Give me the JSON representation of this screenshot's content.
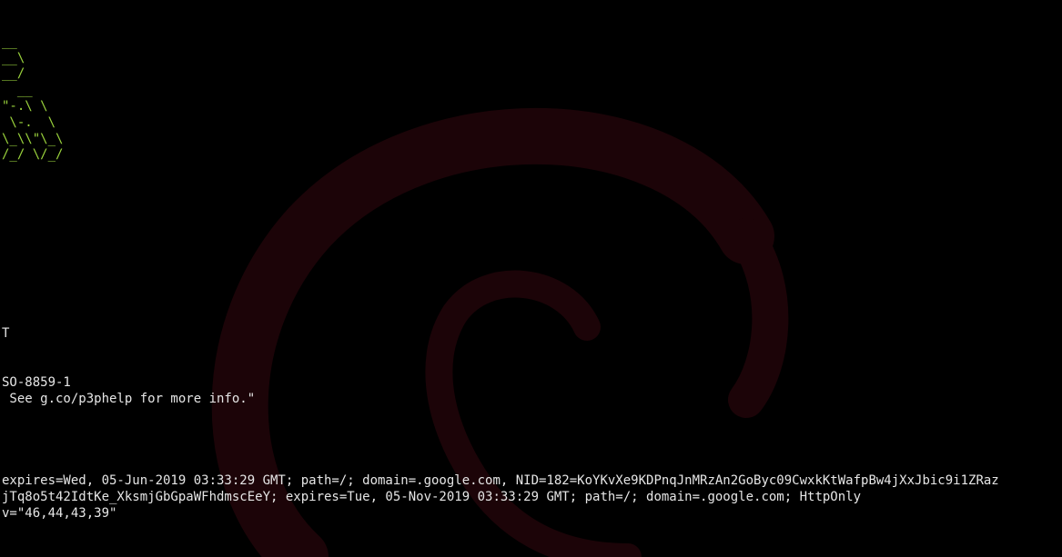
{
  "terminal": {
    "banner": [
      "__",
      "__\\",
      "__/",
      "  __",
      "\"-.\\ \\",
      " \\-.  \\",
      "\\_\\\\\"\\_\\",
      "/_/ \\/_/"
    ],
    "output": [
      "T",
      "SO-8859-1",
      " See g.co/p3phelp for more info.\"",
      "expires=Wed, 05-Jun-2019 03:33:29 GMT; path=/; domain=.google.com, NID=182=KoYKvXe9KDPnqJnMRzAn2GoByc09CwxkKtWafpBw4jXxJbic9i1ZRaz",
      "jTq8o5t42IdtKe_XksmjGbGpaWFhdmscEeY; expires=Tue, 05-Nov-2019 03:33:29 GMT; path=/; domain=.google.com; HttpOnly",
      "v=\"46,44,43,39\""
    ]
  },
  "colors": {
    "background": "#000000",
    "banner_text": "#9ad23c",
    "text": "#e6e6e6",
    "wallpaper_swirl": "#1c0408"
  },
  "icons": {
    "wallpaper": "debian-swirl-icon"
  }
}
